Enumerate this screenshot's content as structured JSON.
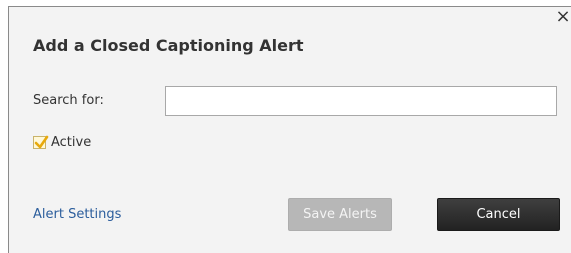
{
  "dialog": {
    "title": "Add a Closed Captioning Alert",
    "close_label": "×"
  },
  "search": {
    "label": "Search for:",
    "value": "",
    "placeholder": ""
  },
  "active": {
    "label": "Active",
    "checked": true
  },
  "footer": {
    "alert_settings_label": "Alert Settings",
    "save_label": "Save Alerts",
    "cancel_label": "Cancel"
  },
  "colors": {
    "link": "#2b5d9c",
    "checkmark": "#e8a90c",
    "save_disabled_bg": "#b7b7b7",
    "cancel_bg": "#2e2e2e"
  }
}
